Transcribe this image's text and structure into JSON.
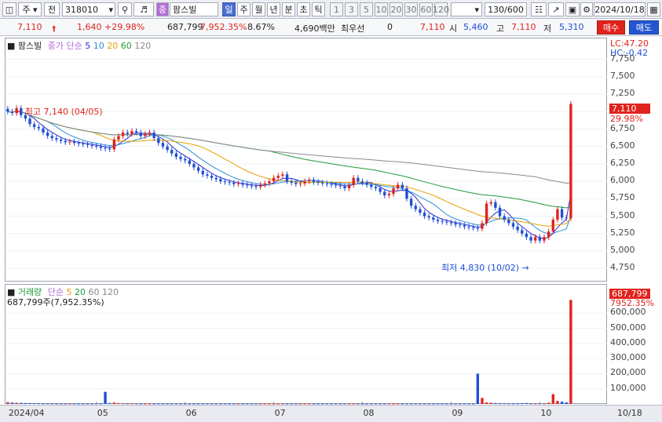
{
  "toolbar": {
    "market": "주",
    "type": "전",
    "code": "318010",
    "group_badge": "종",
    "stock_name": "팜스빌",
    "periods": [
      "일",
      "주",
      "월",
      "년",
      "분",
      "초",
      "틱"
    ],
    "selected_period": "일",
    "intervals": [
      "1",
      "3",
      "5",
      "10",
      "20",
      "30",
      "60",
      "120"
    ],
    "count": "130/600",
    "date": "2024/10/18"
  },
  "quote": {
    "price": "7,110",
    "change": "1,640",
    "change_pct": "+29.98%",
    "volume": "687,799",
    "volume_pct": "7,952.35%",
    "turnover": "8.67%",
    "amount": "4,690백만",
    "best_label": "최우선",
    "best_value": "0",
    "sell_quote": "7,110",
    "open_label": "시",
    "open": "5,460",
    "high_label": "고",
    "high": "7,110",
    "low_label": "저",
    "low": "5,310",
    "buy_button": "매수",
    "sell_button": "매도"
  },
  "price_pane": {
    "name": "팜스빌",
    "ma_label": "종가 단순",
    "ma_periods": [
      "5",
      "10",
      "20",
      "60",
      "120"
    ],
    "ma_colors": [
      "#2b2bd6",
      "#2a8fd8",
      "#e6a000",
      "#1f9a3a",
      "#888888"
    ],
    "lc": "LC:47.20",
    "hc": "HC:-0.42",
    "last_tag": "7,110",
    "last_pct": "29.98%",
    "high_annot": "최고 7,140 (04/05)",
    "low_annot": "최저 4,830 (10/02)"
  },
  "volume_pane": {
    "title": "거래량",
    "ma_label": "단순",
    "ma_periods": [
      "5",
      "20",
      "60",
      "120"
    ],
    "summary": "687,799주(7,952.35%)",
    "last_tag": "687,799",
    "last_pct": "7952.35%"
  },
  "x_axis": [
    "2024/04",
    "05",
    "06",
    "07",
    "08",
    "09",
    "10"
  ],
  "x_axis_right": "10/18",
  "chart_data": {
    "type": "candlestick",
    "price_axis_ticks": [
      "7,750",
      "7,500",
      "7,250",
      "7,000",
      "6,750",
      "6,500",
      "6,250",
      "6,000",
      "5,750",
      "5,500",
      "5,250",
      "5,000",
      "4,750"
    ],
    "price_ylim": [
      4550,
      8050
    ],
    "volume_axis_ticks": [
      "600,000",
      "500,000",
      "400,000",
      "300,000",
      "200,000",
      "100,000"
    ],
    "volume_ylim": [
      0,
      700000
    ],
    "x_range": [
      0,
      130
    ],
    "month_ticks": [
      0,
      20,
      40,
      60,
      80,
      100,
      120
    ],
    "close": [
      7000,
      6980,
      7050,
      6950,
      6900,
      6820,
      6780,
      6760,
      6700,
      6650,
      6620,
      6600,
      6580,
      6560,
      6570,
      6550,
      6540,
      6530,
      6520,
      6510,
      6500,
      6480,
      6470,
      6460,
      6600,
      6650,
      6700,
      6680,
      6720,
      6700,
      6650,
      6680,
      6700,
      6620,
      6550,
      6500,
      6450,
      6400,
      6350,
      6320,
      6300,
      6250,
      6200,
      6150,
      6100,
      6080,
      6050,
      6030,
      6000,
      5990,
      5980,
      5960,
      5970,
      5950,
      5940,
      5930,
      5920,
      5950,
      5970,
      6000,
      6050,
      6080,
      6100,
      6000,
      5980,
      5960,
      5970,
      6000,
      6020,
      5990,
      5980,
      5970,
      5960,
      5950,
      5940,
      5930,
      5900,
      5950,
      6050,
      6000,
      5980,
      5950,
      5920,
      5900,
      5850,
      5800,
      5820,
      5900,
      5950,
      5900,
      5750,
      5650,
      5600,
      5550,
      5500,
      5480,
      5450,
      5430,
      5420,
      5410,
      5400,
      5380,
      5370,
      5350,
      5340,
      5330,
      5320,
      5400,
      5680,
      5700,
      5620,
      5500,
      5450,
      5400,
      5350,
      5300,
      5250,
      5200,
      5150,
      5200,
      5150,
      5200,
      5280,
      5450,
      5600,
      5480,
      5470,
      7110
    ],
    "volume": [
      12000,
      9000,
      8000,
      7000,
      6000,
      6000,
      5000,
      5000,
      4000,
      4000,
      4000,
      3000,
      3000,
      3000,
      3000,
      3000,
      3000,
      3000,
      3000,
      3000,
      4000,
      4000,
      80000,
      6000,
      9000,
      5000,
      5000,
      4000,
      4000,
      4000,
      3000,
      3000,
      3000,
      3000,
      3000,
      3000,
      3000,
      3000,
      3000,
      3000,
      3000,
      3000,
      3000,
      3000,
      3000,
      3000,
      3000,
      3000,
      3000,
      3000,
      3000,
      3000,
      3000,
      3000,
      3000,
      3000,
      3000,
      3000,
      3000,
      3000,
      3000,
      3000,
      3000,
      3000,
      3000,
      3000,
      3000,
      3000,
      3000,
      3000,
      3000,
      3000,
      3000,
      3000,
      3000,
      3000,
      3000,
      3000,
      3000,
      3000,
      3000,
      3000,
      3000,
      3000,
      3000,
      3000,
      3000,
      3000,
      3000,
      3000,
      3000,
      3000,
      3000,
      3000,
      3000,
      3000,
      3000,
      3000,
      3000,
      3000,
      3000,
      3000,
      3000,
      3000,
      3000,
      3000,
      200000,
      40000,
      10000,
      8000,
      6000,
      5000,
      5000,
      4000,
      4000,
      4000,
      5000,
      6000,
      4000,
      4000,
      5000,
      4000,
      8000,
      65000,
      20000,
      15000,
      10000,
      687799
    ]
  }
}
